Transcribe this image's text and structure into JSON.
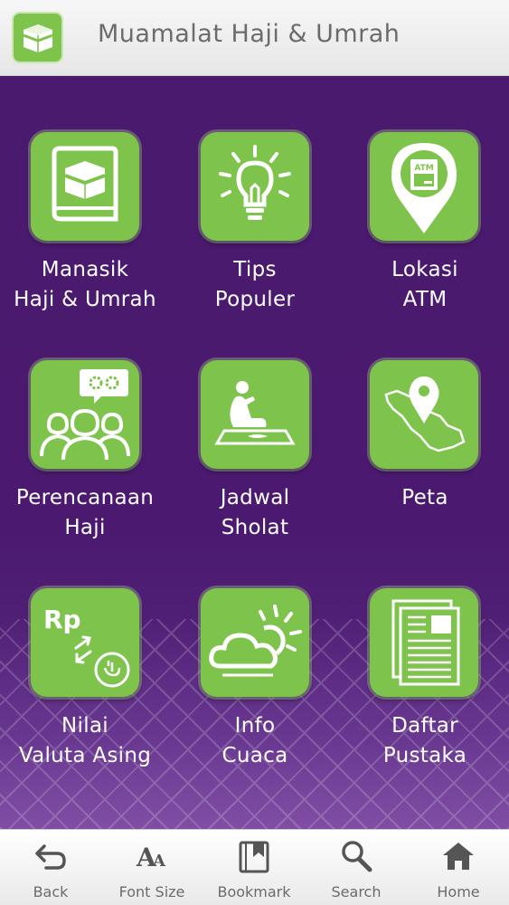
{
  "header": {
    "title": "Muamalat Haji & Umrah",
    "app_icon": "kaaba-icon"
  },
  "menu": [
    {
      "icon": "kaaba-book-icon",
      "line1": "Manasik",
      "line2": "Haji & Umrah"
    },
    {
      "icon": "lightbulb-icon",
      "line1": "Tips",
      "line2": "Populer"
    },
    {
      "icon": "atm-location-icon",
      "line1": "Lokasi",
      "line2": "ATM"
    },
    {
      "icon": "pilgrims-group-icon",
      "line1": "Perencanaan",
      "line2": "Haji"
    },
    {
      "icon": "praying-person-icon",
      "line1": "Jadwal",
      "line2": "Sholat"
    },
    {
      "icon": "map-pin-icon",
      "line1": "Peta",
      "line2": ""
    },
    {
      "icon": "currency-exchange-icon",
      "line1": "Nilai",
      "line2": "Valuta Asing",
      "rp_text": "Rp"
    },
    {
      "icon": "weather-icon",
      "line1": "Info",
      "line2": "Cuaca"
    },
    {
      "icon": "document-list-icon",
      "line1": "Daftar",
      "line2": "Pustaka"
    }
  ],
  "atm_text": "ATM",
  "bottom_bar": [
    {
      "icon": "back-arrow-icon",
      "label": "Back"
    },
    {
      "icon": "font-size-icon",
      "label": "Font Size",
      "glyph": "A"
    },
    {
      "icon": "bookmark-icon",
      "label": "Bookmark"
    },
    {
      "icon": "search-icon",
      "label": "Search"
    },
    {
      "icon": "home-icon",
      "label": "Home"
    }
  ],
  "colors": {
    "tile_green": "#7ec44c",
    "background_purple": "#4a1a6e",
    "header_bg": "#efefef",
    "text_grey": "#6b6b6b"
  }
}
